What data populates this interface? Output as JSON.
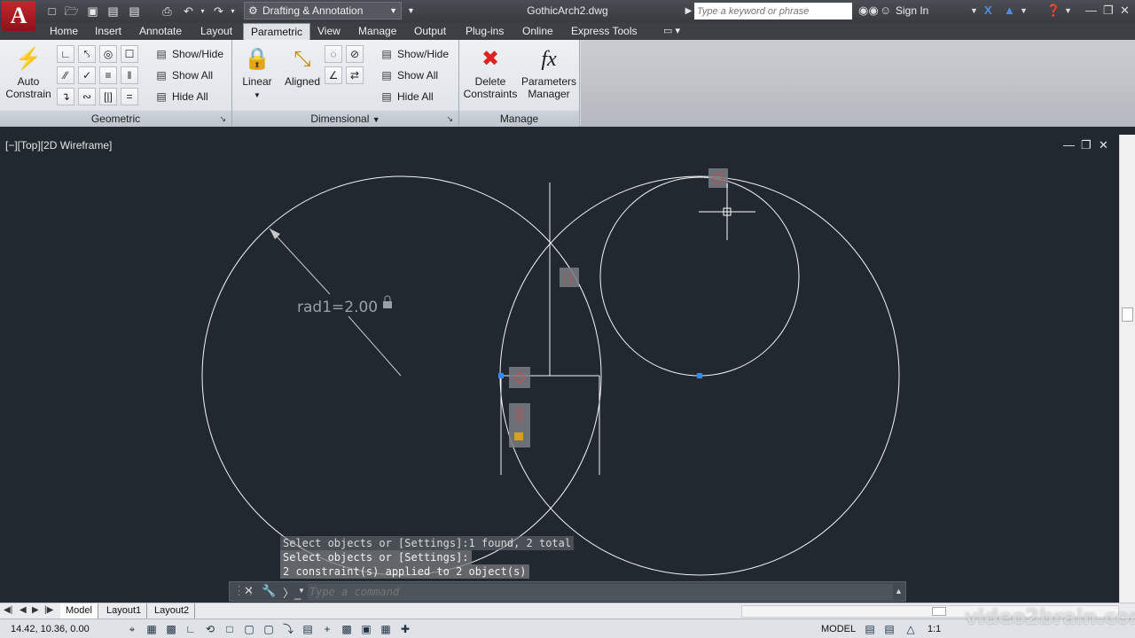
{
  "app": {
    "logo_letter": "A",
    "file_title": "GothicArch2.dwg",
    "workspace": "Drafting & Annotation",
    "search_placeholder": "Type a keyword or phrase",
    "sign_in": "Sign In"
  },
  "ribbon": {
    "tabs": [
      {
        "label": "Home"
      },
      {
        "label": "Insert"
      },
      {
        "label": "Annotate"
      },
      {
        "label": "Layout"
      },
      {
        "label": "Parametric",
        "active": true
      },
      {
        "label": "View"
      },
      {
        "label": "Manage"
      },
      {
        "label": "Output"
      },
      {
        "label": "Plug-ins"
      },
      {
        "label": "Online"
      },
      {
        "label": "Express Tools"
      }
    ],
    "geometric": {
      "title": "Geometric",
      "auto_constrain_line1": "Auto",
      "auto_constrain_line2": "Constrain",
      "show_hide": "Show/Hide",
      "show_all": "Show All",
      "hide_all": "Hide All"
    },
    "dimensional": {
      "title": "Dimensional",
      "linear": "Linear",
      "aligned": "Aligned",
      "show_hide": "Show/Hide",
      "show_all": "Show All",
      "hide_all": "Hide All"
    },
    "manage": {
      "title": "Manage",
      "delete_line1": "Delete",
      "delete_line2": "Constraints",
      "params_line1": "Parameters",
      "params_line2": "Manager",
      "fx_symbol": "fx"
    }
  },
  "viewport": {
    "label": "[−][Top][2D Wireframe]",
    "dimension_label": "rad1=2.00"
  },
  "command": {
    "history": [
      "Select objects or [Settings]:1 found, 2 total",
      "Select objects or [Settings]:",
      "2 constraint(s) applied to 2 object(s)"
    ],
    "placeholder": "Type a command"
  },
  "layout_tabs": [
    {
      "label": "Model",
      "active": true
    },
    {
      "label": "Layout1"
    },
    {
      "label": "Layout2"
    }
  ],
  "status": {
    "coords": "14.42, 10.36, 0.00",
    "model": "MODEL",
    "scale": "1:1"
  },
  "watermark": "video2brain.com"
}
